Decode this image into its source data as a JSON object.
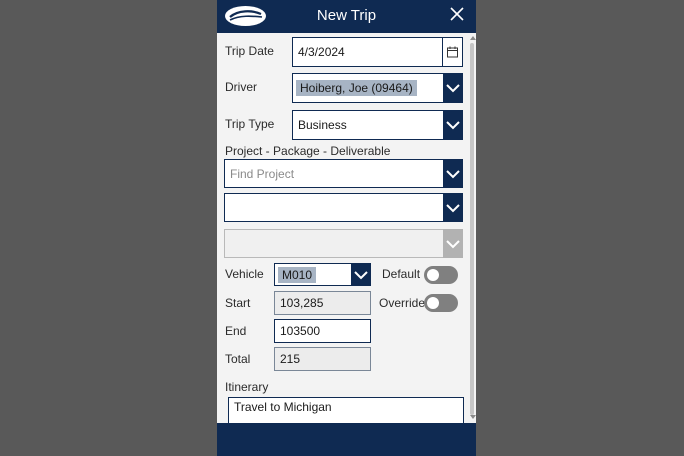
{
  "header": {
    "title": "New Trip",
    "logo_icon": "company-logo",
    "close_icon": "close-icon"
  },
  "form": {
    "trip_date": {
      "label": "Trip Date",
      "value": "4/3/2024",
      "icon": "calendar-icon"
    },
    "driver": {
      "label": "Driver",
      "value": "Hoiberg, Joe (09464)"
    },
    "trip_type": {
      "label": "Trip Type",
      "value": "Business"
    },
    "project_section_label": "Project - Package - Deliverable",
    "project": {
      "placeholder": "Find Project",
      "value": ""
    },
    "package": {
      "value": ""
    },
    "deliverable": {
      "value": "",
      "disabled": true
    },
    "vehicle": {
      "label": "Vehicle",
      "value": "M010"
    },
    "default_toggle": {
      "label": "Default",
      "on": false
    },
    "override_toggle": {
      "label": "Override",
      "on": false
    },
    "start": {
      "label": "Start",
      "value": "103,285"
    },
    "end": {
      "label": "End",
      "value": "103500"
    },
    "total": {
      "label": "Total",
      "value": "215"
    },
    "itinerary": {
      "label": "Itinerary",
      "value": "Travel to Michigan"
    }
  },
  "colors": {
    "brand_navy": "#0f2a52",
    "backdrop": "#595959",
    "panel": "#f3f3f3"
  }
}
